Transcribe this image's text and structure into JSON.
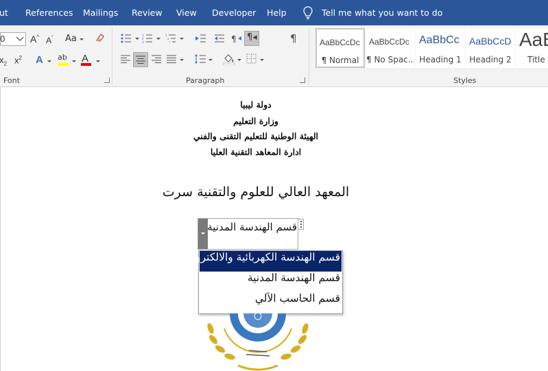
{
  "menu": {
    "items": [
      "ut",
      "References",
      "Mailings",
      "Review",
      "View",
      "Developer",
      "Help"
    ],
    "tell_me": "Tell me what you want to do"
  },
  "ribbon": {
    "font_group_label": "Font",
    "paragraph_group_label": "Paragraph",
    "styles_group_label": "Styles",
    "font_size": "0",
    "change_case_label": "Aa",
    "styles": [
      {
        "sample": "AaBbCcDc",
        "name": "¶ Normal",
        "color": "#000000"
      },
      {
        "sample": "AaBbCcDc",
        "name": "¶ No Spac...",
        "color": "#000000"
      },
      {
        "sample": "AaBbCc",
        "name": "Heading 1",
        "color": "#2f5496"
      },
      {
        "sample": "AaBbCcD",
        "name": "Heading 2",
        "color": "#2f5496"
      },
      {
        "sample": "AaB",
        "name": "Title",
        "color": "#000000"
      }
    ]
  },
  "document": {
    "header_lines": [
      "دولة ليبيا",
      "وزارة التعليم",
      "الهيئة الوطنية للتعليم التقنى والفني",
      "ادارة المعاهد التقنية العليا"
    ],
    "title": "المعهد العالي للعلوم والتقنية سرت",
    "combo_value": "قسم الهندسة المدنية",
    "dropdown_options": [
      "قسم الهندسة الكهربائية والالكترونية",
      "قسم الهندسة المدنية",
      "قسم الحاسب الآلي"
    ],
    "selected_option_index": 0
  },
  "colors": {
    "accent": "#2b579a",
    "selection": "#0a246a",
    "logo_gold": "#d8ad1f",
    "logo_blue": "#3b78c2"
  }
}
